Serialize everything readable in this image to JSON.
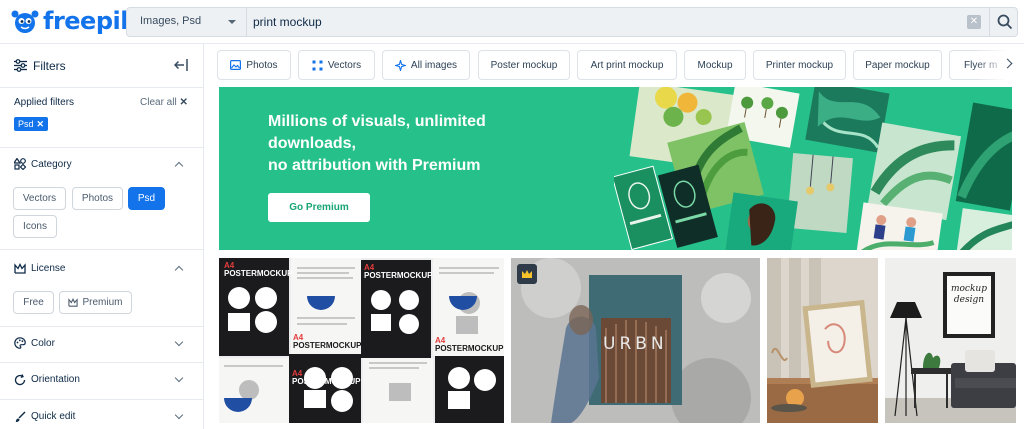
{
  "brand": {
    "name": "freepik",
    "color": "#1273eb"
  },
  "search": {
    "type_selected": "Images, Psd",
    "query": "print mockup",
    "placeholder": "print mockup",
    "clear_icon": "close-icon",
    "submit_icon": "search-icon"
  },
  "sidebar": {
    "title": "Filters",
    "applied_filters_label": "Applied filters",
    "clear_all_label": "Clear all",
    "applied_tags": [
      {
        "label": "Psd"
      }
    ],
    "category": {
      "title": "Category",
      "options": [
        "Vectors",
        "Photos",
        "Psd",
        "Icons"
      ],
      "selected": "Psd"
    },
    "license": {
      "title": "License",
      "options": [
        "Free",
        "Premium"
      ]
    },
    "collapsed_sections": [
      "Color",
      "Orientation",
      "Quick edit"
    ]
  },
  "tags": [
    {
      "label": "Photos",
      "icon": "image-icon"
    },
    {
      "label": "Vectors",
      "icon": "vector-icon"
    },
    {
      "label": "All images",
      "icon": "sparkle-icon"
    },
    {
      "label": "Poster mockup"
    },
    {
      "label": "Art print mockup"
    },
    {
      "label": "Mockup"
    },
    {
      "label": "Printer mockup"
    },
    {
      "label": "Paper mockup"
    },
    {
      "label": "Flyer m"
    }
  ],
  "banner": {
    "line1": "Millions of visuals, unlimited",
    "line2": "downloads,",
    "line3_prefix": "no attribution with ",
    "line3_bold": "Premium",
    "cta": "Go Premium",
    "accent": "#26c08b"
  },
  "results": {
    "poster_label_top": "A4",
    "poster_label_main": "POSTERMOCKUP",
    "urbn_text": "URBN",
    "frame_text": "mockup design"
  }
}
